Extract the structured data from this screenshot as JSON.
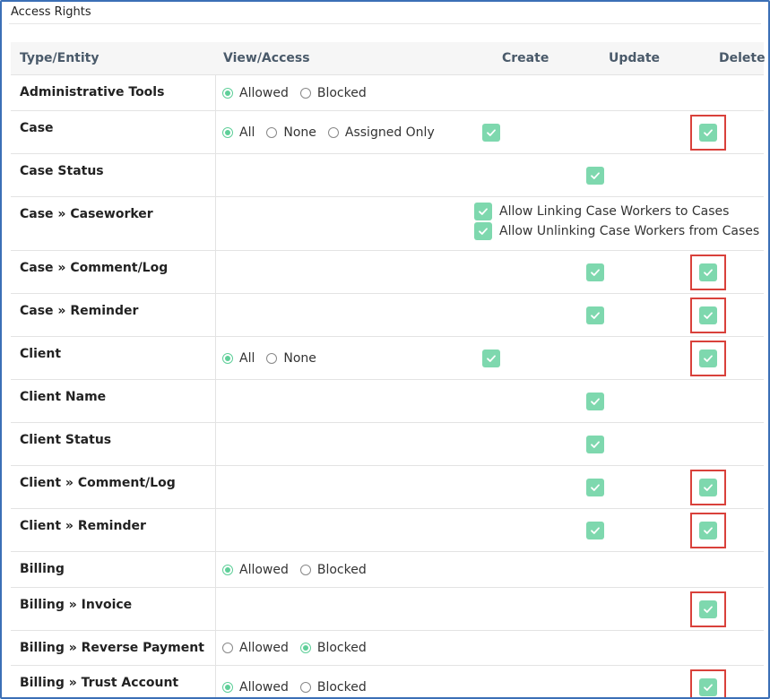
{
  "panel": {
    "title": "Access Rights"
  },
  "columns": {
    "entity": "Type/Entity",
    "view": "View/Access",
    "create": "Create",
    "update": "Update",
    "delete": "Delete"
  },
  "rows": [
    {
      "entity": "Administrative Tools",
      "view": [
        {
          "label": "Allowed",
          "checked": true
        },
        {
          "label": "Blocked",
          "checked": false
        }
      ],
      "create": false,
      "update": false,
      "delete": false,
      "delete_highlighted": false
    },
    {
      "entity": "Case",
      "view": [
        {
          "label": "All",
          "checked": true
        },
        {
          "label": "None",
          "checked": false
        },
        {
          "label": "Assigned Only",
          "checked": false
        }
      ],
      "create": true,
      "update": false,
      "delete": true,
      "delete_highlighted": true
    },
    {
      "entity": "Case Status",
      "view": [],
      "create": false,
      "update": true,
      "delete": false,
      "delete_highlighted": false
    },
    {
      "entity": "Case » Caseworker",
      "view": [],
      "create": false,
      "update": false,
      "delete": false,
      "delete_highlighted": false,
      "options": [
        {
          "label": "Allow Linking Case Workers to Cases",
          "checked": true
        },
        {
          "label": "Allow Unlinking Case Workers from Cases",
          "checked": true
        }
      ]
    },
    {
      "entity": "Case » Comment/Log",
      "view": [],
      "create": false,
      "update": true,
      "delete": true,
      "delete_highlighted": true
    },
    {
      "entity": "Case » Reminder",
      "view": [],
      "create": false,
      "update": true,
      "delete": true,
      "delete_highlighted": true
    },
    {
      "entity": "Client",
      "view": [
        {
          "label": "All",
          "checked": true
        },
        {
          "label": "None",
          "checked": false
        }
      ],
      "create": true,
      "update": false,
      "delete": true,
      "delete_highlighted": true
    },
    {
      "entity": "Client Name",
      "view": [],
      "create": false,
      "update": true,
      "delete": false,
      "delete_highlighted": false
    },
    {
      "entity": "Client Status",
      "view": [],
      "create": false,
      "update": true,
      "delete": false,
      "delete_highlighted": false
    },
    {
      "entity": "Client » Comment/Log",
      "view": [],
      "create": false,
      "update": true,
      "delete": true,
      "delete_highlighted": true
    },
    {
      "entity": "Client » Reminder",
      "view": [],
      "create": false,
      "update": true,
      "delete": true,
      "delete_highlighted": true
    },
    {
      "entity": "Billing",
      "view": [
        {
          "label": "Allowed",
          "checked": true
        },
        {
          "label": "Blocked",
          "checked": false
        }
      ],
      "create": false,
      "update": false,
      "delete": false,
      "delete_highlighted": false
    },
    {
      "entity": "Billing » Invoice",
      "view": [],
      "create": false,
      "update": false,
      "delete": true,
      "delete_highlighted": true
    },
    {
      "entity": "Billing » Reverse Payment",
      "view": [
        {
          "label": "Allowed",
          "checked": false
        },
        {
          "label": "Blocked",
          "checked": true
        }
      ],
      "create": false,
      "update": false,
      "delete": false,
      "delete_highlighted": false
    },
    {
      "entity": "Billing » Trust Account",
      "view": [
        {
          "label": "Allowed",
          "checked": true
        },
        {
          "label": "Blocked",
          "checked": false
        }
      ],
      "create": false,
      "update": false,
      "delete": true,
      "delete_highlighted": true
    }
  ],
  "colors": {
    "accent": "#7ed8ae",
    "highlight": "#d9413b",
    "frame": "#3b6fb6"
  }
}
